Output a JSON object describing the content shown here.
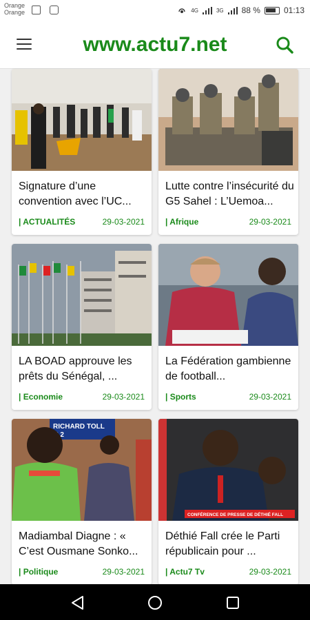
{
  "status": {
    "carrier1": "Orange",
    "carrier2": "Orange",
    "signal1": "4G",
    "signal2": "3G",
    "battery": "88 %",
    "time": "01:13"
  },
  "header": {
    "brand": "www.actu7.net",
    "menu_icon": "hamburger-menu-icon",
    "search_icon": "search-icon"
  },
  "articles": [
    {
      "title": "Signature d’une convention avec l’UC...",
      "category": "| ACTUALITÉS",
      "date": "29-03-2021"
    },
    {
      "title": "Lutte contre l’insécurité du G5 Sahel : L’Uemoa...",
      "category": "| Afrique",
      "date": "29-03-2021"
    },
    {
      "title": "LA BOAD approuve les prêts du Sénégal, ...",
      "category": "| Economie",
      "date": "29-03-2021"
    },
    {
      "title": "La Fédération gambienne de football...",
      "category": "| Sports",
      "date": "29-03-2021"
    },
    {
      "title": "Madiambal Diagne : « C’est Ousmane Sonko...",
      "category": "| Politique",
      "date": "29-03-2021"
    },
    {
      "title": "Déthié Fall crée le Parti républicain pour ...",
      "category": "| Actu7 Tv",
      "date": "29-03-2021"
    }
  ],
  "overlays": {
    "tv_banner": "CONFÉRENCE DE PRESSE DE DÉTHIÉ FALL",
    "tv_sign": "RICHARD TOLL",
    "tv_sign_number": "8.2"
  },
  "navigation": {
    "back_icon": "back-triangle-icon",
    "home_icon": "home-circle-icon",
    "recents_icon": "recents-square-icon"
  }
}
